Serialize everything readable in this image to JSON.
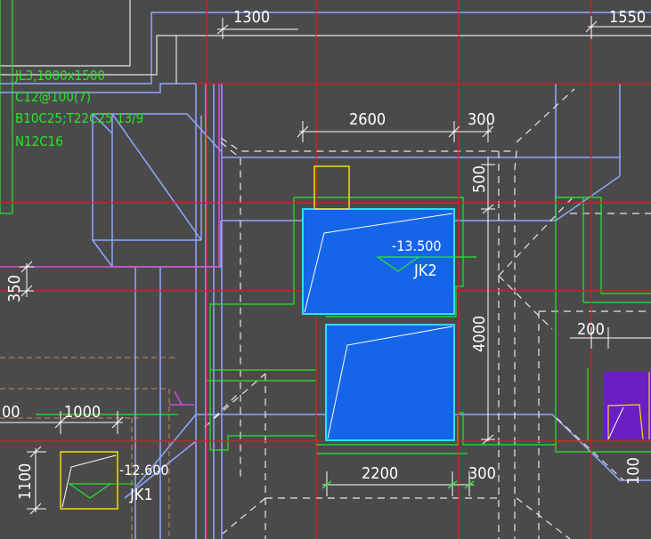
{
  "colors": {
    "background": "#4a4a4a",
    "axis_red": "#e01a1a",
    "beam_blue": "#8fa8ff",
    "wall_green": "#27e52a",
    "dim_white": "#ffffff",
    "pit_fill": "#1565e8",
    "pit_outline": "#33d9ff",
    "magenta": "#d84bd8",
    "purple_fill": "#6a1fc4",
    "yellow": "#f0e000",
    "orange_dashed": "#c88a52"
  },
  "beam_annotation": {
    "line1": "JL3,1000x1500",
    "line2": "C12@100(7)",
    "line3": "B10C25;T22C25 13/9",
    "line4": "N12C16"
  },
  "dimensions": {
    "top_left": "1300",
    "top_right": "1550",
    "pit_width": "2600",
    "pit_gap": "300",
    "pit_top_offset": "500",
    "left_vertical": "350",
    "pit_height": "4000",
    "lower_width": "2200",
    "lower_gap": "300",
    "right_small": "200",
    "right_bottom": "100",
    "left_partial": "00",
    "left_width": "1000",
    "left_height": "1100"
  },
  "pits": {
    "jk2": {
      "label": "JK2",
      "elevation": "-13.500"
    },
    "jk1": {
      "label": "JK1",
      "elevation": "-12.600"
    }
  }
}
